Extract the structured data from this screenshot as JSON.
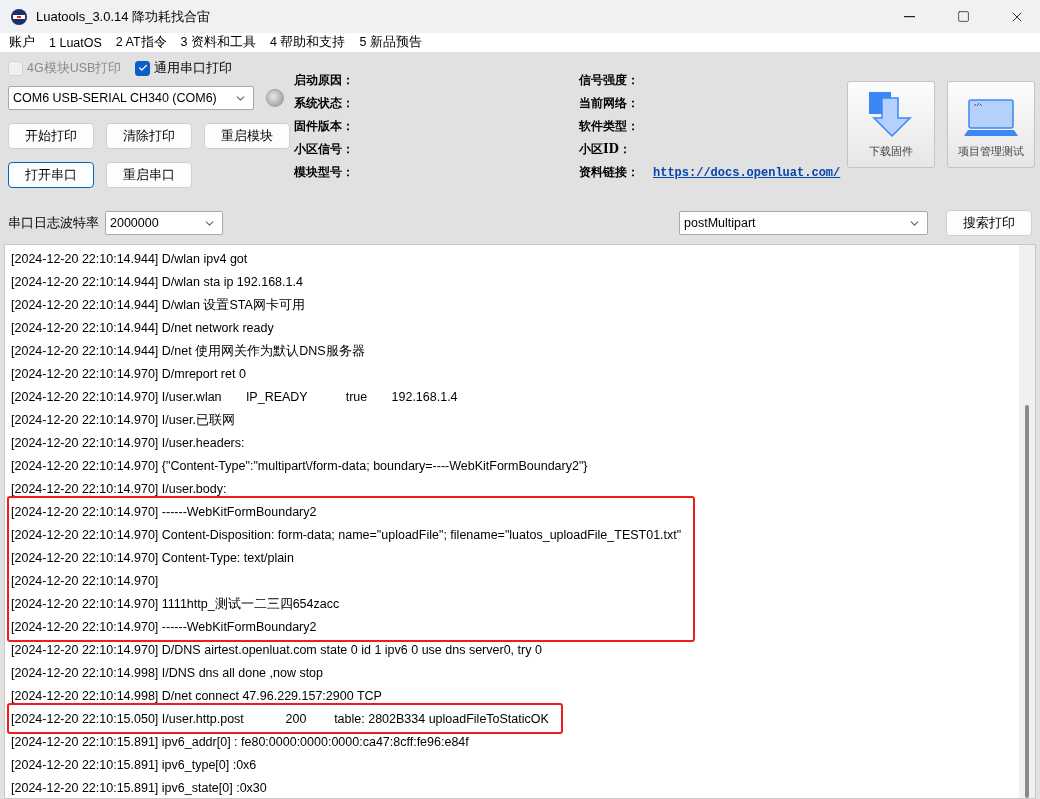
{
  "window": {
    "title": "Luatools_3.0.14 降功耗找合宙"
  },
  "menu": [
    "账户",
    "1 LuatOS",
    "2 AT指令",
    "3 资料和工具",
    "4 帮助和支持",
    "5 新品预告"
  ],
  "checkboxes": [
    {
      "label": "4G模块USB打印",
      "checked": false,
      "disabled": true
    },
    {
      "label": "通用串口打印",
      "checked": true,
      "disabled": false
    }
  ],
  "port_select": {
    "value": "COM6 USB-SERIAL CH340 (COM6)",
    "connected": false
  },
  "button_rows": [
    [
      {
        "label": "开始打印",
        "focused": false
      },
      {
        "label": "清除打印",
        "focused": false
      },
      {
        "label": "重启模块",
        "focused": false
      }
    ],
    [
      {
        "label": "打开串口",
        "focused": true
      },
      {
        "label": "重启串口",
        "focused": false
      }
    ]
  ],
  "info": {
    "left": [
      {
        "label": "启动原因："
      },
      {
        "label": "系统状态："
      },
      {
        "label": "固件版本："
      },
      {
        "label": "小区信号："
      },
      {
        "label": "模块型号："
      }
    ],
    "right": [
      {
        "label": "信号强度："
      },
      {
        "label": "当前网络："
      },
      {
        "label": "软件类型："
      },
      {
        "label": "小区ID："
      },
      {
        "label": "资料链接：",
        "link": "https://docs.openluat.com/"
      }
    ]
  },
  "big_buttons": [
    {
      "label": "下载固件",
      "kind": "download"
    },
    {
      "label": "项目管理测试",
      "kind": "project"
    }
  ],
  "baud": {
    "label": "串口日志波特率",
    "value": "2000000"
  },
  "search": {
    "value": "postMultipart",
    "button": "搜索打印"
  },
  "log": [
    {
      "highlighted": false,
      "lines": [
        "[2024-12-20 22:10:14.944] D/wlan ipv4 got",
        "[2024-12-20 22:10:14.944] D/wlan sta ip 192.168.1.4",
        "[2024-12-20 22:10:14.944] D/wlan 设置STA网卡可用",
        "[2024-12-20 22:10:14.944] D/net network ready",
        "[2024-12-20 22:10:14.944] D/net 使用网关作为默认DNS服务器",
        "[2024-12-20 22:10:14.970] D/mreport ret 0",
        "[2024-12-20 22:10:14.970] I/user.wlan       IP_READY           true       192.168.1.4",
        "[2024-12-20 22:10:14.970] I/user.已联网",
        "[2024-12-20 22:10:14.970] I/user.headers:",
        "[2024-12-20 22:10:14.970] {\"Content-Type\":\"multipart\\/form-data; boundary=----WebKitFormBoundary2\"}",
        "[2024-12-20 22:10:14.970] I/user.body:"
      ]
    },
    {
      "highlighted": true,
      "lines": [
        "[2024-12-20 22:10:14.970] ------WebKitFormBoundary2",
        "[2024-12-20 22:10:14.970] Content-Disposition: form-data; name=\"uploadFile\"; filename=\"luatos_uploadFile_TEST01.txt\"",
        "[2024-12-20 22:10:14.970] Content-Type: text/plain",
        "[2024-12-20 22:10:14.970]",
        "[2024-12-20 22:10:14.970] 1111http_测试一二三四654zacc",
        "[2024-12-20 22:10:14.970] ------WebKitFormBoundary2"
      ]
    },
    {
      "highlighted": false,
      "lines": [
        "[2024-12-20 22:10:14.970] D/DNS airtest.openluat.com state 0 id 1 ipv6 0 use dns server0, try 0",
        "[2024-12-20 22:10:14.998] I/DNS dns all done ,now stop",
        "[2024-12-20 22:10:14.998] D/net connect 47.96.229.157:2900 TCP"
      ]
    },
    {
      "highlighted": true,
      "lines": [
        "[2024-12-20 22:10:15.050] I/user.http.post            200        table: 2802B334 uploadFileToStaticOK"
      ]
    },
    {
      "highlighted": false,
      "lines": [
        "[2024-12-20 22:10:15.891] ipv6_addr[0] : fe80:0000:0000:0000:ca47:8cff:fe96:e84f",
        "[2024-12-20 22:10:15.891] ipv6_type[0] :0x6",
        "[2024-12-20 22:10:15.891] ipv6_state[0] :0x30"
      ]
    }
  ]
}
